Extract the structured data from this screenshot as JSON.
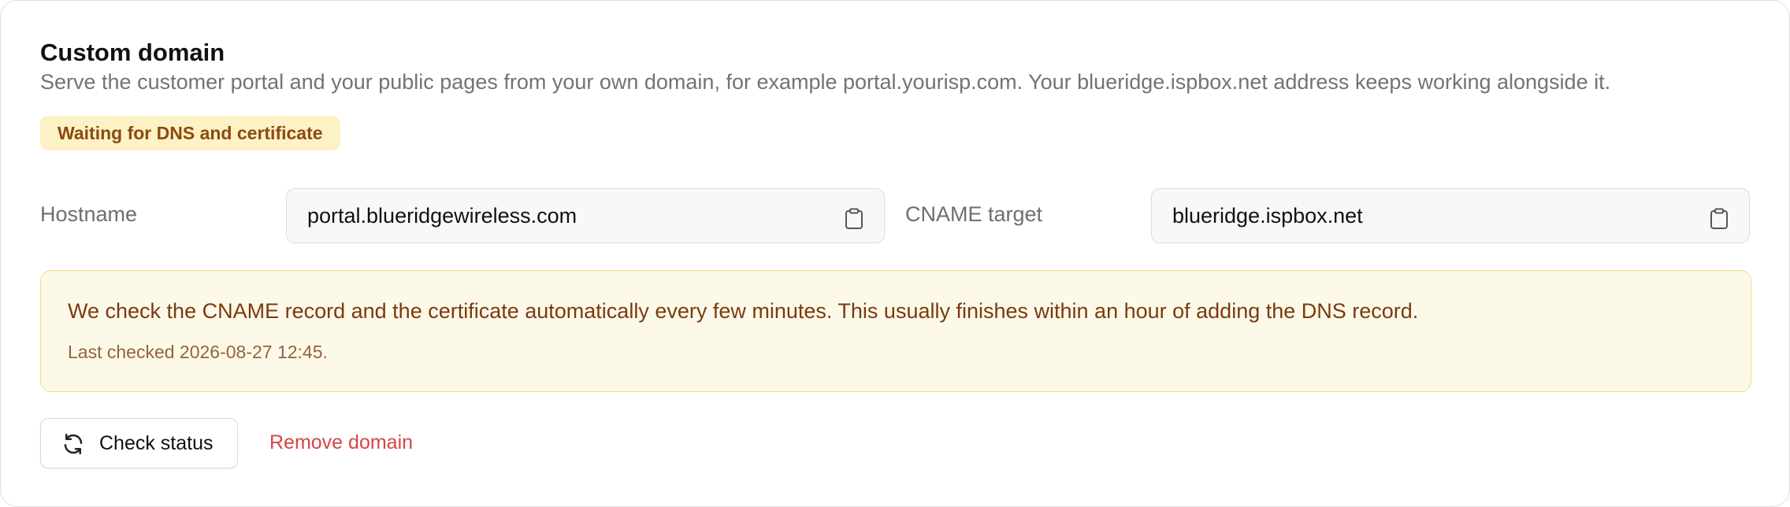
{
  "section": {
    "title": "Custom domain",
    "description": "Serve the customer portal and your public pages from your own domain, for example portal.yourisp.com. Your blueridge.ispbox.net address keeps working alongside it."
  },
  "status_badge": {
    "label": "Waiting for DNS and certificate",
    "background": "#fdf1c6",
    "color": "#8a4b0f"
  },
  "fields": {
    "hostname": {
      "label": "Hostname",
      "value": "portal.blueridgewireless.com",
      "copy_icon": "clipboard-icon"
    },
    "cname": {
      "label": "CNAME target",
      "value": "blueridge.ispbox.net",
      "copy_icon": "clipboard-icon"
    }
  },
  "notice": {
    "message": "We check the CNAME record and the certificate automatically every few minutes. This usually finishes within an hour of adding the DNS record.",
    "last_checked": "Last checked 2026-08-27 12:45.",
    "background": "#fdf9e9",
    "border": "#f4dd84"
  },
  "actions": {
    "check_status": {
      "label": "Check status",
      "icon": "refresh-icon"
    },
    "remove_domain": {
      "label": "Remove domain",
      "color": "#d64545"
    }
  }
}
